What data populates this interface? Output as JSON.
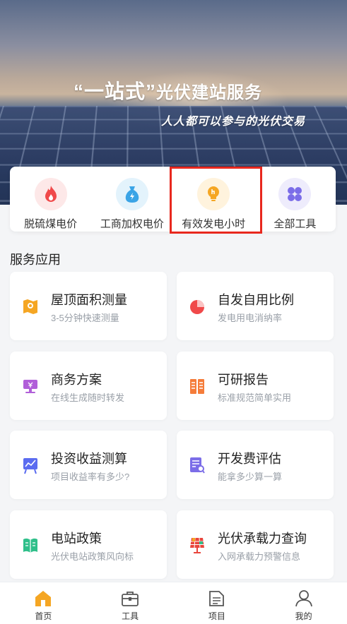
{
  "banner": {
    "title_quote_open": "“",
    "title_main": "一站式",
    "title_quote_close": "”",
    "title_rest": "光伏建站服务",
    "subtitle": "人人都可以参与的光伏交易"
  },
  "quick_tools": [
    {
      "label": "脱硫煤电价",
      "icon": "flame-icon",
      "bg": "#fde8e8",
      "color": "#f0494a"
    },
    {
      "label": "工商加权电价",
      "icon": "money-bag-icon",
      "bg": "#e3f3fc",
      "color": "#3aa4e6"
    },
    {
      "label": "有效发电小时",
      "icon": "bulb-icon",
      "bg": "#fff3dd",
      "color": "#f5a623"
    },
    {
      "label": "全部工具",
      "icon": "grid-icon",
      "bg": "#eeecfc",
      "color": "#7b6de8"
    }
  ],
  "services_title": "服务应用",
  "services": [
    {
      "title": "屋顶面积测量",
      "subtitle": "3-5分钟快速测量",
      "icon": "map-pin-icon",
      "color": "#f5a623"
    },
    {
      "title": "自发自用比例",
      "subtitle": "发电用电消纳率",
      "icon": "pie-icon",
      "color": "#f0494a"
    },
    {
      "title": "商务方案",
      "subtitle": "在线生成随时转发",
      "icon": "monitor-icon",
      "color": "#b15fd9"
    },
    {
      "title": "可研报告",
      "subtitle": "标准规范简单实用",
      "icon": "report-icon",
      "color": "#f57c3a"
    },
    {
      "title": "投资收益测算",
      "subtitle": "项目收益率有多少?",
      "icon": "chart-board-icon",
      "color": "#5b6cf0"
    },
    {
      "title": "开发费评估",
      "subtitle": "能拿多少算一算",
      "icon": "document-search-icon",
      "color": "#7b6de8"
    },
    {
      "title": "电站政策",
      "subtitle": "光伏电站政策风向标",
      "icon": "book-icon",
      "color": "#2fbf8a"
    },
    {
      "title": "光伏承载力查询",
      "subtitle": "入网承载力预警信息",
      "icon": "solar-panel-icon",
      "color": "#e8453c"
    }
  ],
  "tabs": [
    {
      "label": "首页",
      "icon": "home-icon",
      "active": true
    },
    {
      "label": "工具",
      "icon": "toolbox-icon",
      "active": false
    },
    {
      "label": "项目",
      "icon": "folder-icon",
      "active": false
    },
    {
      "label": "我的",
      "icon": "user-icon",
      "active": false
    }
  ],
  "colors": {
    "highlight": "#e8281e",
    "active_tab": "#f5a623"
  }
}
